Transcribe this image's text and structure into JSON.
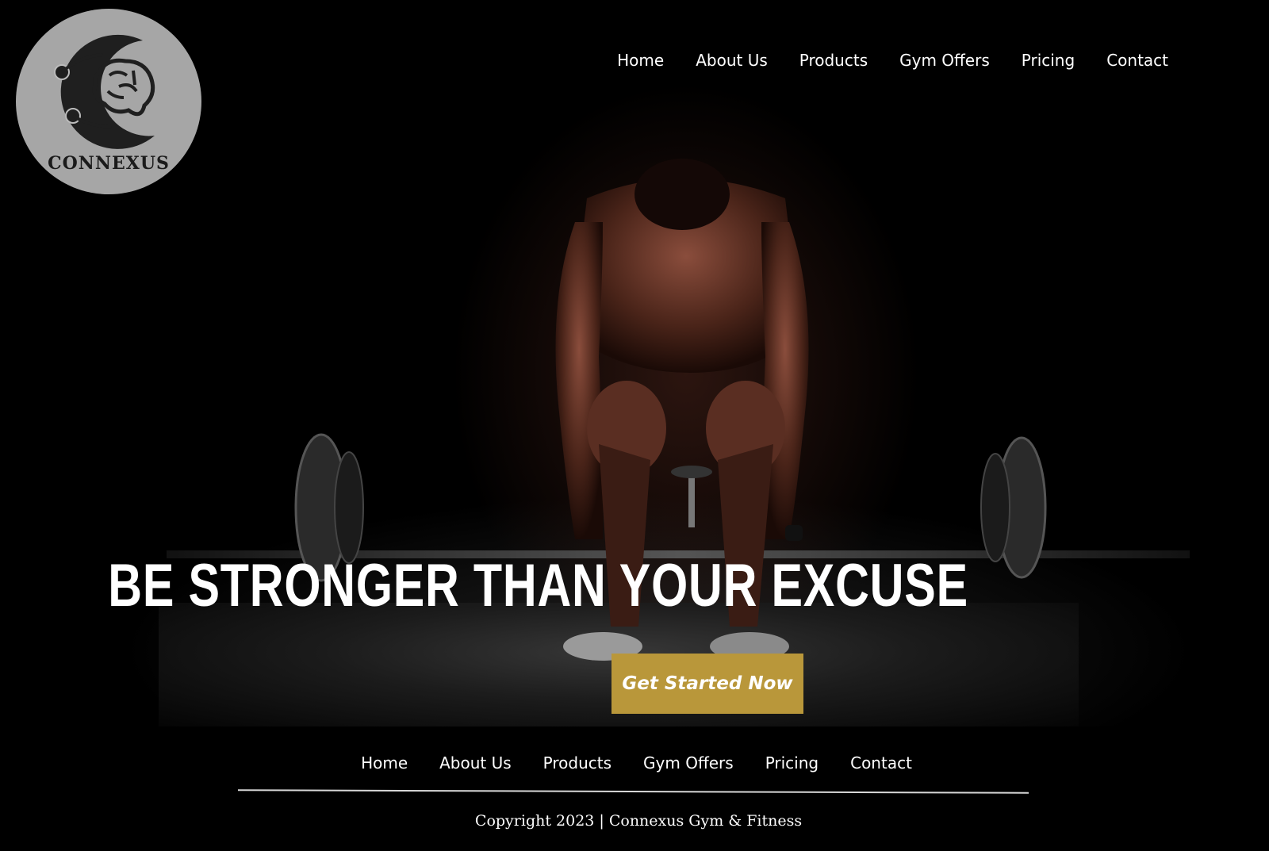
{
  "brand": {
    "logo_text": "CONNEXUS"
  },
  "top_nav": {
    "items": [
      {
        "label": "Home"
      },
      {
        "label": "About Us"
      },
      {
        "label": "Products"
      },
      {
        "label": "Gym Offers"
      },
      {
        "label": "Pricing"
      },
      {
        "label": "Contact"
      }
    ]
  },
  "hero": {
    "headline": "BE STRONGER THAN YOUR EXCUSE",
    "cta_label": "Get Started Now"
  },
  "footer": {
    "nav": [
      {
        "label": "Home"
      },
      {
        "label": "About Us"
      },
      {
        "label": "Products"
      },
      {
        "label": "Gym Offers"
      },
      {
        "label": "Pricing"
      },
      {
        "label": "Contact"
      }
    ],
    "copyright": "Copyright 2023 |  Connexus Gym & Fitness"
  },
  "colors": {
    "background": "#000000",
    "accent_gold": "#b9973a",
    "logo_circle": "#a6a6a6",
    "text": "#ffffff"
  },
  "icons": {
    "logo_mark": "brain-crescent-icon"
  }
}
